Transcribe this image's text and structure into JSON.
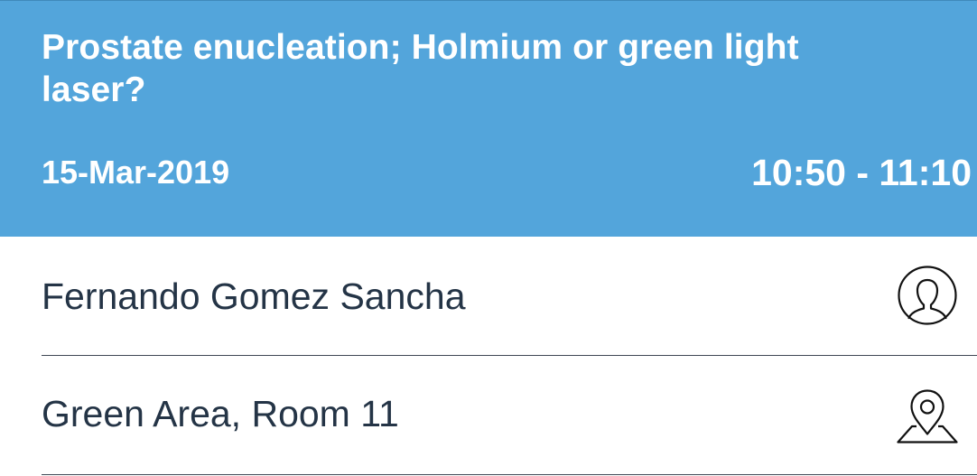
{
  "session": {
    "title": "Prostate enucleation; Holmium or green light laser?",
    "date": "15-Mar-2019",
    "time": "10:50 - 11:10"
  },
  "details": {
    "speaker": "Fernando Gomez Sancha",
    "location": "Green Area, Room 11"
  },
  "icons": {
    "speaker": "person-circle-icon",
    "location": "map-pin-icon"
  },
  "colors": {
    "header_background": "#53a5db",
    "header_text": "#ffffff",
    "body_text": "#243446",
    "divider": "#3e4754"
  }
}
